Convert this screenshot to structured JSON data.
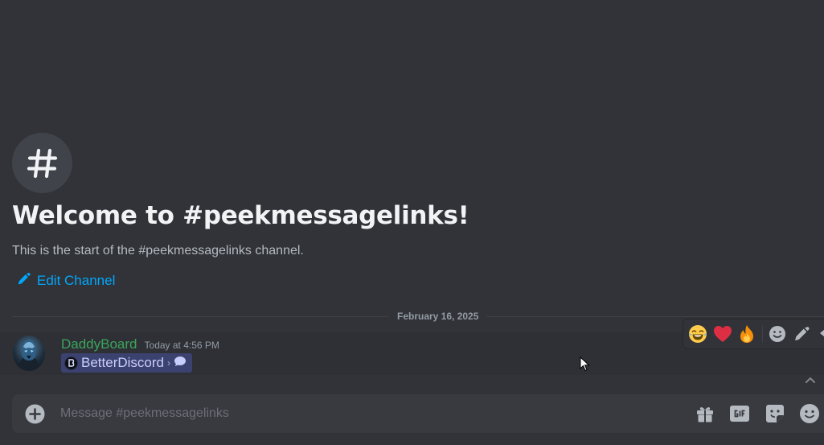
{
  "channel": {
    "icon": "hashtag-icon",
    "welcome_title": "Welcome to #peekmessagelinks!",
    "welcome_subtitle": "This is the start of the #peekmessagelinks channel.",
    "edit_label": "Edit Channel"
  },
  "divider": {
    "date": "February 16, 2025"
  },
  "message": {
    "username": "DaddyBoard",
    "timestamp": "Today at 4:56 PM",
    "mention": {
      "label": "BetterDiscord",
      "chevron": "›",
      "trailing_icon": "chat-bubble-icon"
    }
  },
  "toolbar": {
    "reactions": [
      "😂",
      "❤️",
      "🔥"
    ],
    "actions": [
      "add-reaction-icon",
      "edit-icon",
      "reply-icon"
    ]
  },
  "composer": {
    "placeholder": "Message #peekmessagelinks",
    "icons": [
      "add-icon",
      "gift-icon",
      "gif-icon",
      "sticker-icon",
      "emoji-icon"
    ]
  },
  "colors": {
    "background": "#313338",
    "link": "#00a8fc",
    "username": "#3ba55c",
    "mention_bg": "#3c4270"
  }
}
